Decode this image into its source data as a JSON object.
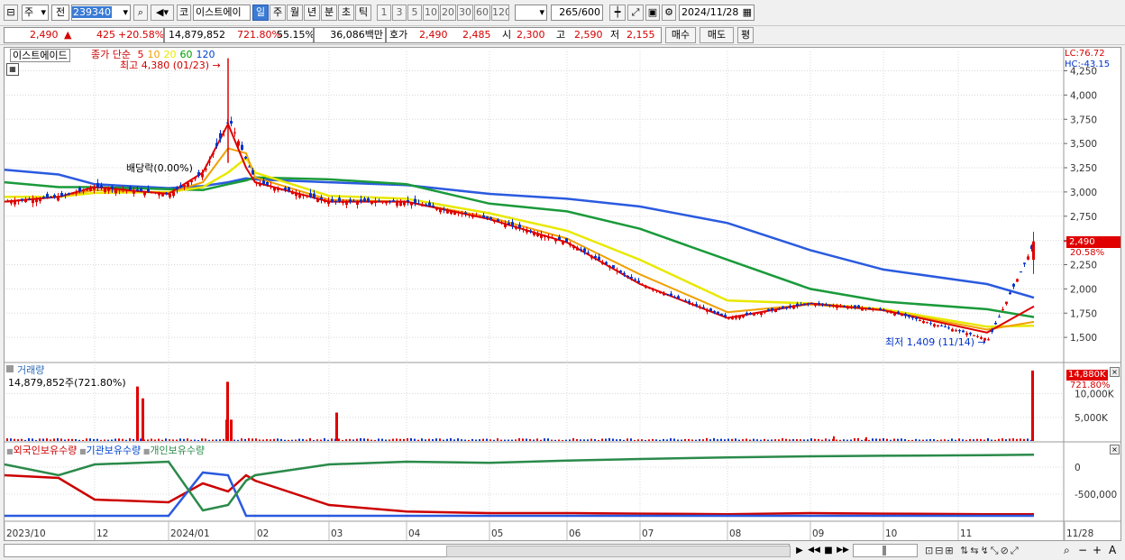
{
  "toolbar": {
    "market": "주",
    "scope": "전",
    "code": "239340",
    "mode": "코",
    "name": "이스트에이",
    "periods": [
      "일",
      "주",
      "월",
      "년",
      "분",
      "초",
      "틱"
    ],
    "selected_period": "일",
    "intervals": [
      "1",
      "3",
      "5",
      "10",
      "20",
      "30",
      "60",
      "120"
    ],
    "count": "265",
    "max": "/600",
    "date": "2024/11/28"
  },
  "quote": {
    "price": "2,490",
    "arrow": "▲",
    "change": "425",
    "change_pct": "+20.58%",
    "volume": "14,879,852",
    "volume_pct": "721.80%",
    "turnover_pct": "55.15%",
    "amount": "36,086백만",
    "bid_label": "호가",
    "bid": "2,490",
    "ask": "2,485",
    "open_label": "시",
    "open": "2,300",
    "high_label": "고",
    "high": "2,590",
    "low_label": "저",
    "low": "2,155",
    "buy_button": "매수",
    "sell_button": "매도",
    "eval_button": "평"
  },
  "chart": {
    "name_tab": "이스트에이드",
    "legend_title": "종가 단순",
    "ma_labels": [
      {
        "label": "5",
        "color": "#dd0000"
      },
      {
        "label": "10",
        "color": "#f0a000"
      },
      {
        "label": "20",
        "color": "#e8e800"
      },
      {
        "label": "60",
        "color": "#00a000"
      },
      {
        "label": "120",
        "color": "#0044cc"
      }
    ],
    "high_note": "최고 4,380 (01/23)",
    "low_note": "최저 1,409 (11/14)",
    "div_note": "배당락(0.00%)",
    "lc": "LC:76.72",
    "hc": "HC:-43.15",
    "price_badge": "2,490",
    "price_pct": "20.58%",
    "volume_title": "거래량",
    "volume_text": "14,879,852주(721.80%)",
    "volume_badge": "14,880K",
    "volume_pct": "721.80%",
    "holding_labels": [
      {
        "label": "외국인보유수량",
        "color": "#cc0000"
      },
      {
        "label": "기관보유수량",
        "color": "#0044cc"
      },
      {
        "label": "개인보유수량",
        "color": "#2a8a4a"
      }
    ],
    "x_labels": [
      "2023/10",
      "12",
      "2024/01",
      "02",
      "03",
      "04",
      "05",
      "06",
      "07",
      "08",
      "09",
      "10",
      "11",
      "11/28"
    ]
  },
  "chart_data": [
    {
      "type": "candlestick",
      "title": "이스트에이드",
      "y_ticks": [
        4250,
        4000,
        3750,
        3500,
        3250,
        3000,
        2750,
        2500,
        2250,
        2000,
        1750,
        1500
      ],
      "ylim": [
        1250,
        4450
      ],
      "last_price": 2490,
      "high": {
        "value": 4380,
        "date": "01/23"
      },
      "low": {
        "value": 1409,
        "date": "11/14"
      },
      "close_series": {
        "x": [
          "2023/10",
          "2023/11",
          "2023/12",
          "2024/01/05",
          "2024/01/15",
          "2024/01/23",
          "2024/01/29",
          "2024/02",
          "2024/03",
          "2024/04",
          "2024/05",
          "2024/06",
          "2024/07",
          "2024/08",
          "2024/09",
          "2024/10",
          "2024/11/14",
          "2024/11/28"
        ],
        "values": [
          2900,
          2950,
          3050,
          2980,
          3200,
          3750,
          3300,
          3100,
          2900,
          2900,
          2720,
          2480,
          2050,
          1700,
          1850,
          1780,
          1480,
          2490
        ]
      },
      "ma": [
        {
          "name": "5",
          "values": [
            2900,
            2950,
            3050,
            2980,
            3200,
            3700,
            3250,
            3100,
            2900,
            2900,
            2720,
            2480,
            2050,
            1700,
            1850,
            1780,
            1550,
            1820
          ]
        },
        {
          "name": "10",
          "values": [
            2900,
            2950,
            3020,
            2990,
            3100,
            3450,
            3400,
            3150,
            2920,
            2900,
            2740,
            2520,
            2150,
            1760,
            1840,
            1780,
            1580,
            1660
          ]
        },
        {
          "name": "20",
          "values": [
            2950,
            2950,
            2990,
            3000,
            3050,
            3200,
            3350,
            3200,
            2960,
            2930,
            2780,
            2600,
            2300,
            1880,
            1850,
            1790,
            1610,
            1620
          ]
        },
        {
          "name": "60",
          "values": [
            3100,
            3050,
            3050,
            3030,
            3020,
            3080,
            3120,
            3150,
            3130,
            3080,
            2880,
            2800,
            2620,
            2300,
            2000,
            1870,
            1790,
            1710
          ]
        },
        {
          "name": "120",
          "values": [
            3230,
            3180,
            3080,
            3040,
            3060,
            3100,
            3140,
            3130,
            3100,
            3070,
            2980,
            2930,
            2850,
            2680,
            2400,
            2200,
            2050,
            1910
          ]
        }
      ]
    },
    {
      "type": "bar",
      "title": "거래량",
      "y_ticks": [
        "10,000K",
        "5,000K"
      ],
      "spikes": [
        {
          "x": "2023/12",
          "value": 11500
        },
        {
          "x": "2023/12",
          "value": 9000
        },
        {
          "x": "2024/01/23",
          "value": 12500
        },
        {
          "x": "2024/01/24",
          "value": 4500
        },
        {
          "x": "2024/02/27",
          "value": 6000
        },
        {
          "x": "2024/11/28",
          "value": 14880
        }
      ]
    },
    {
      "type": "line",
      "title": "보유수량",
      "y_ticks": [
        "0",
        "-500,000"
      ],
      "series": [
        {
          "name": "외국인보유수량",
          "values": [
            -150000,
            -200000,
            -600000,
            -650000,
            -300000,
            -450000,
            -150000,
            -250000,
            -700000,
            -820000,
            -850000,
            -850000,
            -860000,
            -870000,
            -850000,
            -860000,
            -870000,
            -870000
          ]
        },
        {
          "name": "기관보유수량",
          "values": [
            -900000,
            -900000,
            -900000,
            -900000,
            -100000,
            -150000,
            -900000,
            -900000,
            -900000,
            -900000,
            -900000,
            -900000,
            -900000,
            -900000,
            -900000,
            -900000,
            -900000,
            -900000
          ]
        },
        {
          "name": "개인보유수량",
          "values": [
            50000,
            -150000,
            50000,
            100000,
            -800000,
            -700000,
            -250000,
            -150000,
            50000,
            100000,
            80000,
            120000,
            150000,
            180000,
            200000,
            210000,
            220000,
            230000
          ]
        }
      ]
    }
  ]
}
